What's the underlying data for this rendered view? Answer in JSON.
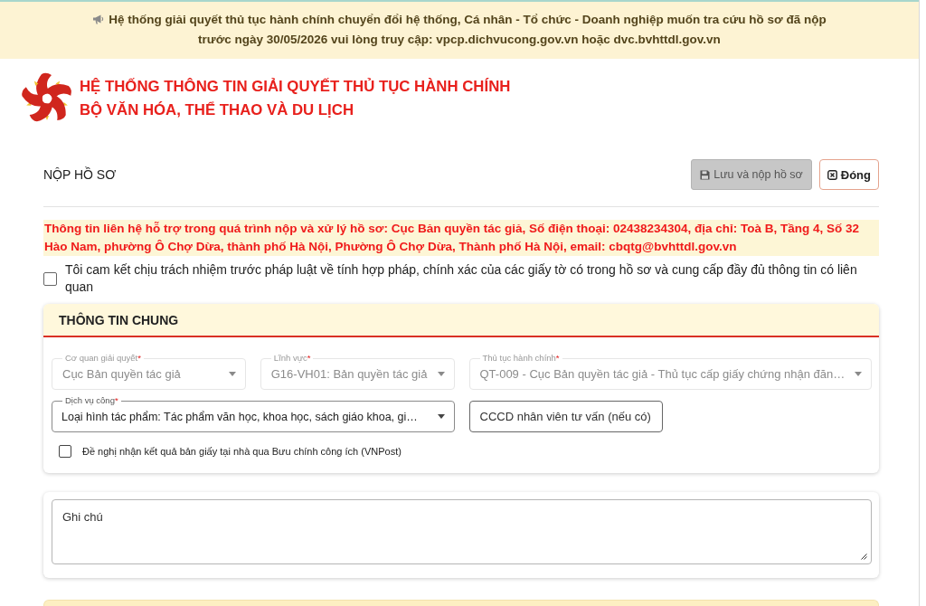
{
  "notice_banner": {
    "text": "Hệ thống giải quyết thủ tục hành chính chuyển đổi hệ thống, Cá nhân - Tổ chức - Doanh nghiệp muốn tra cứu hồ sơ đã nộp trước ngày 30/05/2026 vui lòng truy cập: vpcp.dichvucong.gov.vn hoặc dvc.bvhttdl.gov.vn"
  },
  "header": {
    "title_lines": [
      "HỆ THỐNG THÔNG TIN GIẢI QUYẾT THỦ TỤC HÀNH CHÍNH",
      "BỘ VĂN HÓA, THỂ THAO VÀ DU LỊCH"
    ]
  },
  "page": {
    "title": "NỘP HỒ SƠ",
    "buttons": [
      {
        "kind": "save",
        "label": "Lưu và nộp hồ sơ",
        "disabled": true
      },
      {
        "kind": "close",
        "label": "Đóng",
        "disabled": false
      }
    ]
  },
  "support_notice": "Thông tin liên hệ hỗ trợ trong quá trình nộp và xử lý hồ sơ: Cục Bản quyền tác giả, Số điện thoại: 02438234304, địa chỉ: Toà B, Tầng 4, Số 32 Hào Nam, phường Ô Chợ Dừa, thành phố Hà Nội, Phường Ô Chợ Dừa, Thành phố Hà Nội, email: cbqtg@bvhttdl.gov.vn",
  "commitment": {
    "label": "Tôi cam kết chịu trách nhiệm trước pháp luật về tính hợp pháp, chính xác của các giấy tờ có trong hồ sơ và cung cấp đầy đủ thông tin có liên quan",
    "checked": false
  },
  "general_info": {
    "title": "THÔNG TIN CHUNG",
    "fields": [
      {
        "kind": "select",
        "label": "Cơ quan giải quyết",
        "required_mark": "*",
        "value": "Cục Bản quyền tác giả",
        "disabled": true
      },
      {
        "kind": "select",
        "label": "Lĩnh vực",
        "required_mark": "*",
        "value": "G16-VH01: Bản quyền tác giả",
        "disabled": true
      },
      {
        "kind": "select",
        "label": "Thủ tục hành chính",
        "required_mark": "*",
        "value": "QT-009 - Cục Bản quyền tác giả - Thủ tục cấp giấy chứng nhận đăn…",
        "disabled": true
      },
      {
        "kind": "select",
        "label": "Dịch vụ công",
        "required_mark": "*",
        "value": "Loại hình tác phẩm: Tác phẩm văn học, khoa học, sách giáo khoa, gi…",
        "disabled": false
      },
      {
        "kind": "text",
        "placeholder": "CCCD nhân viên tư vấn (nếu có)"
      }
    ],
    "postal_option": {
      "label": "Đề nghị nhận kết quả bản giấy tại nhà qua Bưu chính công ích (VNPost)",
      "checked": false
    }
  },
  "notes": {
    "placeholder": "Ghi chú"
  }
}
